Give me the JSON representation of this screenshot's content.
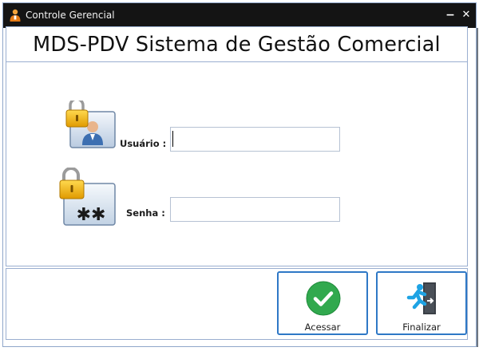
{
  "window": {
    "title": "Controle Gerencial",
    "minimize_symbol": "−",
    "close_symbol": "✕"
  },
  "header": {
    "title": "MDS-PDV Sistema de Gestão Comercial"
  },
  "form": {
    "user_label": "Usuário :",
    "user_value": "",
    "password_label": "Senha :",
    "password_value": "",
    "password_icon_text": "✱✱"
  },
  "actions": {
    "login_label": "Acessar",
    "exit_label": "Finalizar"
  },
  "icons": {
    "app": "user-in-orange-icon",
    "user": "padlock-user-icon",
    "password": "padlock-asterisks-icon",
    "login": "green-check-circle-icon",
    "exit": "running-man-exit-icon"
  },
  "colors": {
    "titlebar": "#141414",
    "panel_border": "#9aaed0",
    "button_border": "#2e78c6",
    "check_green": "#31a94e",
    "exit_blue": "#1ea3e4"
  }
}
